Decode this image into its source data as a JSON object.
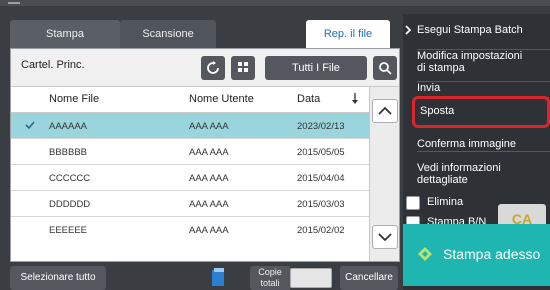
{
  "tabs": [
    {
      "label": "Stampa"
    },
    {
      "label": "Scansione"
    },
    {
      "label": "Rep. il file"
    }
  ],
  "toolbar": {
    "folder_label": "Cartel. Princ.",
    "filter_button": "Tutti I File"
  },
  "table": {
    "headers": {
      "file_name": "Nome File",
      "user_name": "Nome Utente",
      "date": "Data"
    },
    "rows": [
      {
        "file": "AAAAAA",
        "user": "AAA AAA",
        "date": "2023/02/13",
        "selected": true
      },
      {
        "file": "BBBBBB",
        "user": "AAA AAA",
        "date": "2015/05/05",
        "selected": false
      },
      {
        "file": "CCCCCC",
        "user": "AAA AAA",
        "date": "2015/04/04",
        "selected": false
      },
      {
        "file": "DDDDDD",
        "user": "AAA AAA",
        "date": "2015/03/03",
        "selected": false
      },
      {
        "file": "EEEEEE",
        "user": "AAA AAA",
        "date": "2015/02/02",
        "selected": false
      }
    ]
  },
  "bottom": {
    "select_all": "Selezionare tutto",
    "copies_label_line1": "Copie",
    "copies_label_line2": "totali",
    "cancel": "Cancellare"
  },
  "side_menu": {
    "items": [
      {
        "label": "Esegui Stampa Batch"
      },
      {
        "label_line1": "Modifica impostazioni",
        "label_line2": "di stampa"
      },
      {
        "label": "Invia"
      },
      {
        "label": "Sposta"
      },
      {
        "label": "Conferma immagine"
      },
      {
        "label_line1": "Vedi informazioni",
        "label_line2": "dettagliate"
      }
    ],
    "delete_label": "Elimina",
    "bw_label": "Stampa B/N",
    "ca_label": "CA",
    "print_now": "Stampa adesso"
  },
  "colors": {
    "selected_row": "#9ad5de",
    "highlight": "#d9262e",
    "print_now_bg": "#1fb5b0",
    "active_tab_text": "#1a6fc7"
  }
}
